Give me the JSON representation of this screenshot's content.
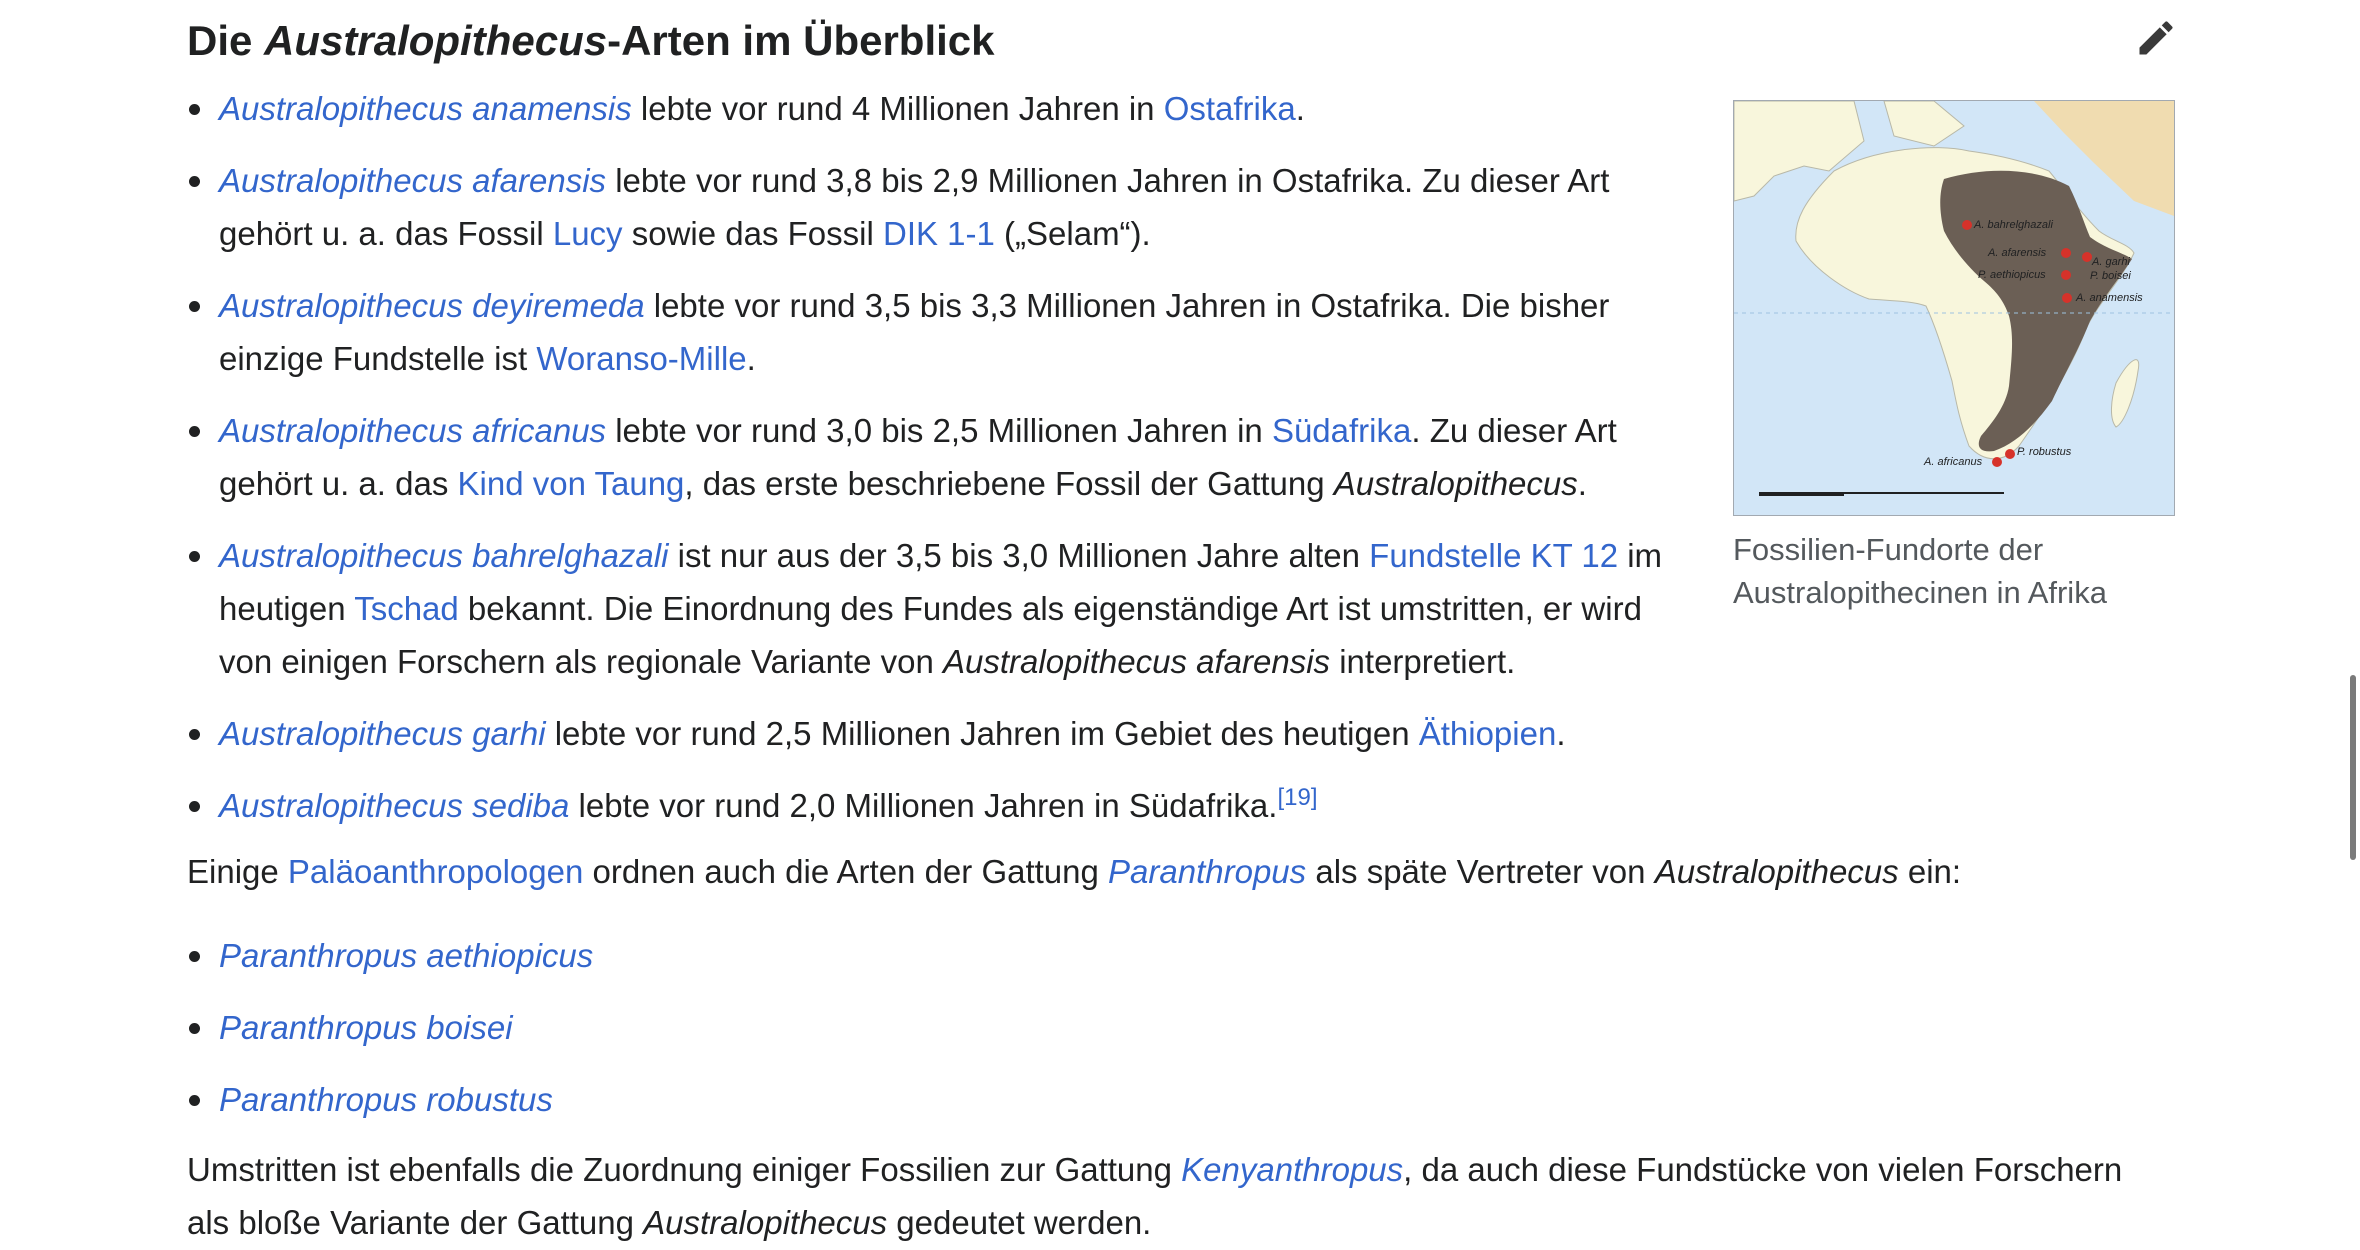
{
  "heading": {
    "prefix": "Die ",
    "italic": "Australopithecus",
    "suffix": "-Arten im Überblick"
  },
  "figure": {
    "caption": "Fossilien-Fundorte der Australopithecinen in Afrika",
    "map_labels": [
      "A. bahrelghazali",
      "A. afarensis",
      "P. aethiopicus",
      "A. garhi",
      "P. boisei",
      "A. anamensis",
      "A. africanus",
      "P. robustus"
    ]
  },
  "species": [
    {
      "name": "Australopithecus anamensis",
      "t1": " lebte vor rund 4 Millionen Jahren in ",
      "link1": "Ostafrika",
      "t2": "."
    },
    {
      "name": "Australopithecus afarensis",
      "t1": " lebte vor rund 3,8 bis 2,9 Millionen Jahren in Ostafrika. Zu dieser Art gehört u. a. das Fossil ",
      "link1": "Lucy",
      "t2": " sowie das Fossil ",
      "link2": "DIK 1-1",
      "t3": " („Selam“)."
    },
    {
      "name": "Australopithecus deyiremeda",
      "t1": " lebte vor rund 3,5 bis 3,3 Millionen Jahren in Ostafrika. Die bisher einzige Fundstelle ist ",
      "link1": "Woranso-Mille",
      "t2": "."
    },
    {
      "name": "Australopithecus africanus",
      "t1": " lebte vor rund 3,0 bis 2,5 Millionen Jahren in ",
      "link1": "Südafrika",
      "t2": ". Zu dieser Art gehört u. a. das ",
      "link2": "Kind von Taung",
      "t3": ", das erste beschriebene Fossil der Gattung ",
      "italic": "Australopithecus",
      "t4": "."
    },
    {
      "name": "Australopithecus bahrelghazali",
      "t1": " ist nur aus der 3,5 bis 3,0 Millionen Jahre alten ",
      "link1": "Fundstelle KT 12",
      "t2": " im heutigen ",
      "link2": "Tschad",
      "t3": " bekannt. Die Einordnung des Fundes als eigenständige Art ist umstritten, er wird von einigen Forschern als regionale Variante von ",
      "italic": "Australopithecus afarensis",
      "t4": " interpretiert."
    },
    {
      "name": "Australopithecus garhi",
      "t1": " lebte vor rund 2,5 Millionen Jahren im Gebiet des heutigen ",
      "link1": "Äthiopien",
      "t2": "."
    },
    {
      "name": "Australopithecus sediba",
      "t1": " lebte vor rund 2,0 Millionen Jahren in Südafrika.",
      "ref": "[19]"
    }
  ],
  "para1": {
    "t1": "Einige ",
    "link1": "Paläoanthropologen",
    "t2": " ordnen auch die Arten der Gattung ",
    "link2": "Paranthropus",
    "t3": " als späte Vertreter von ",
    "italic": "Australopithecus",
    "t4": " ein:"
  },
  "paranthropus": [
    "Paranthropus aethiopicus",
    "Paranthropus boisei",
    "Paranthropus robustus"
  ],
  "para2": {
    "t1": "Umstritten ist ebenfalls die Zuordnung einiger Fossilien zur Gattung ",
    "link1": "Kenyanthropus",
    "t2": ", da auch diese Fundstücke von vielen Forschern als bloße Variante der Gattung ",
    "italic": "Australopithecus",
    "t3": " gedeutet werden."
  },
  "colors": {
    "link": "#3366cc",
    "text": "#202122",
    "caption": "#54595d",
    "ocean": "#d2e6f7",
    "land": "#f8f6dc",
    "range": "#6b5f55",
    "site": "#d6322a"
  },
  "icons": {
    "edit": "pencil-icon"
  }
}
